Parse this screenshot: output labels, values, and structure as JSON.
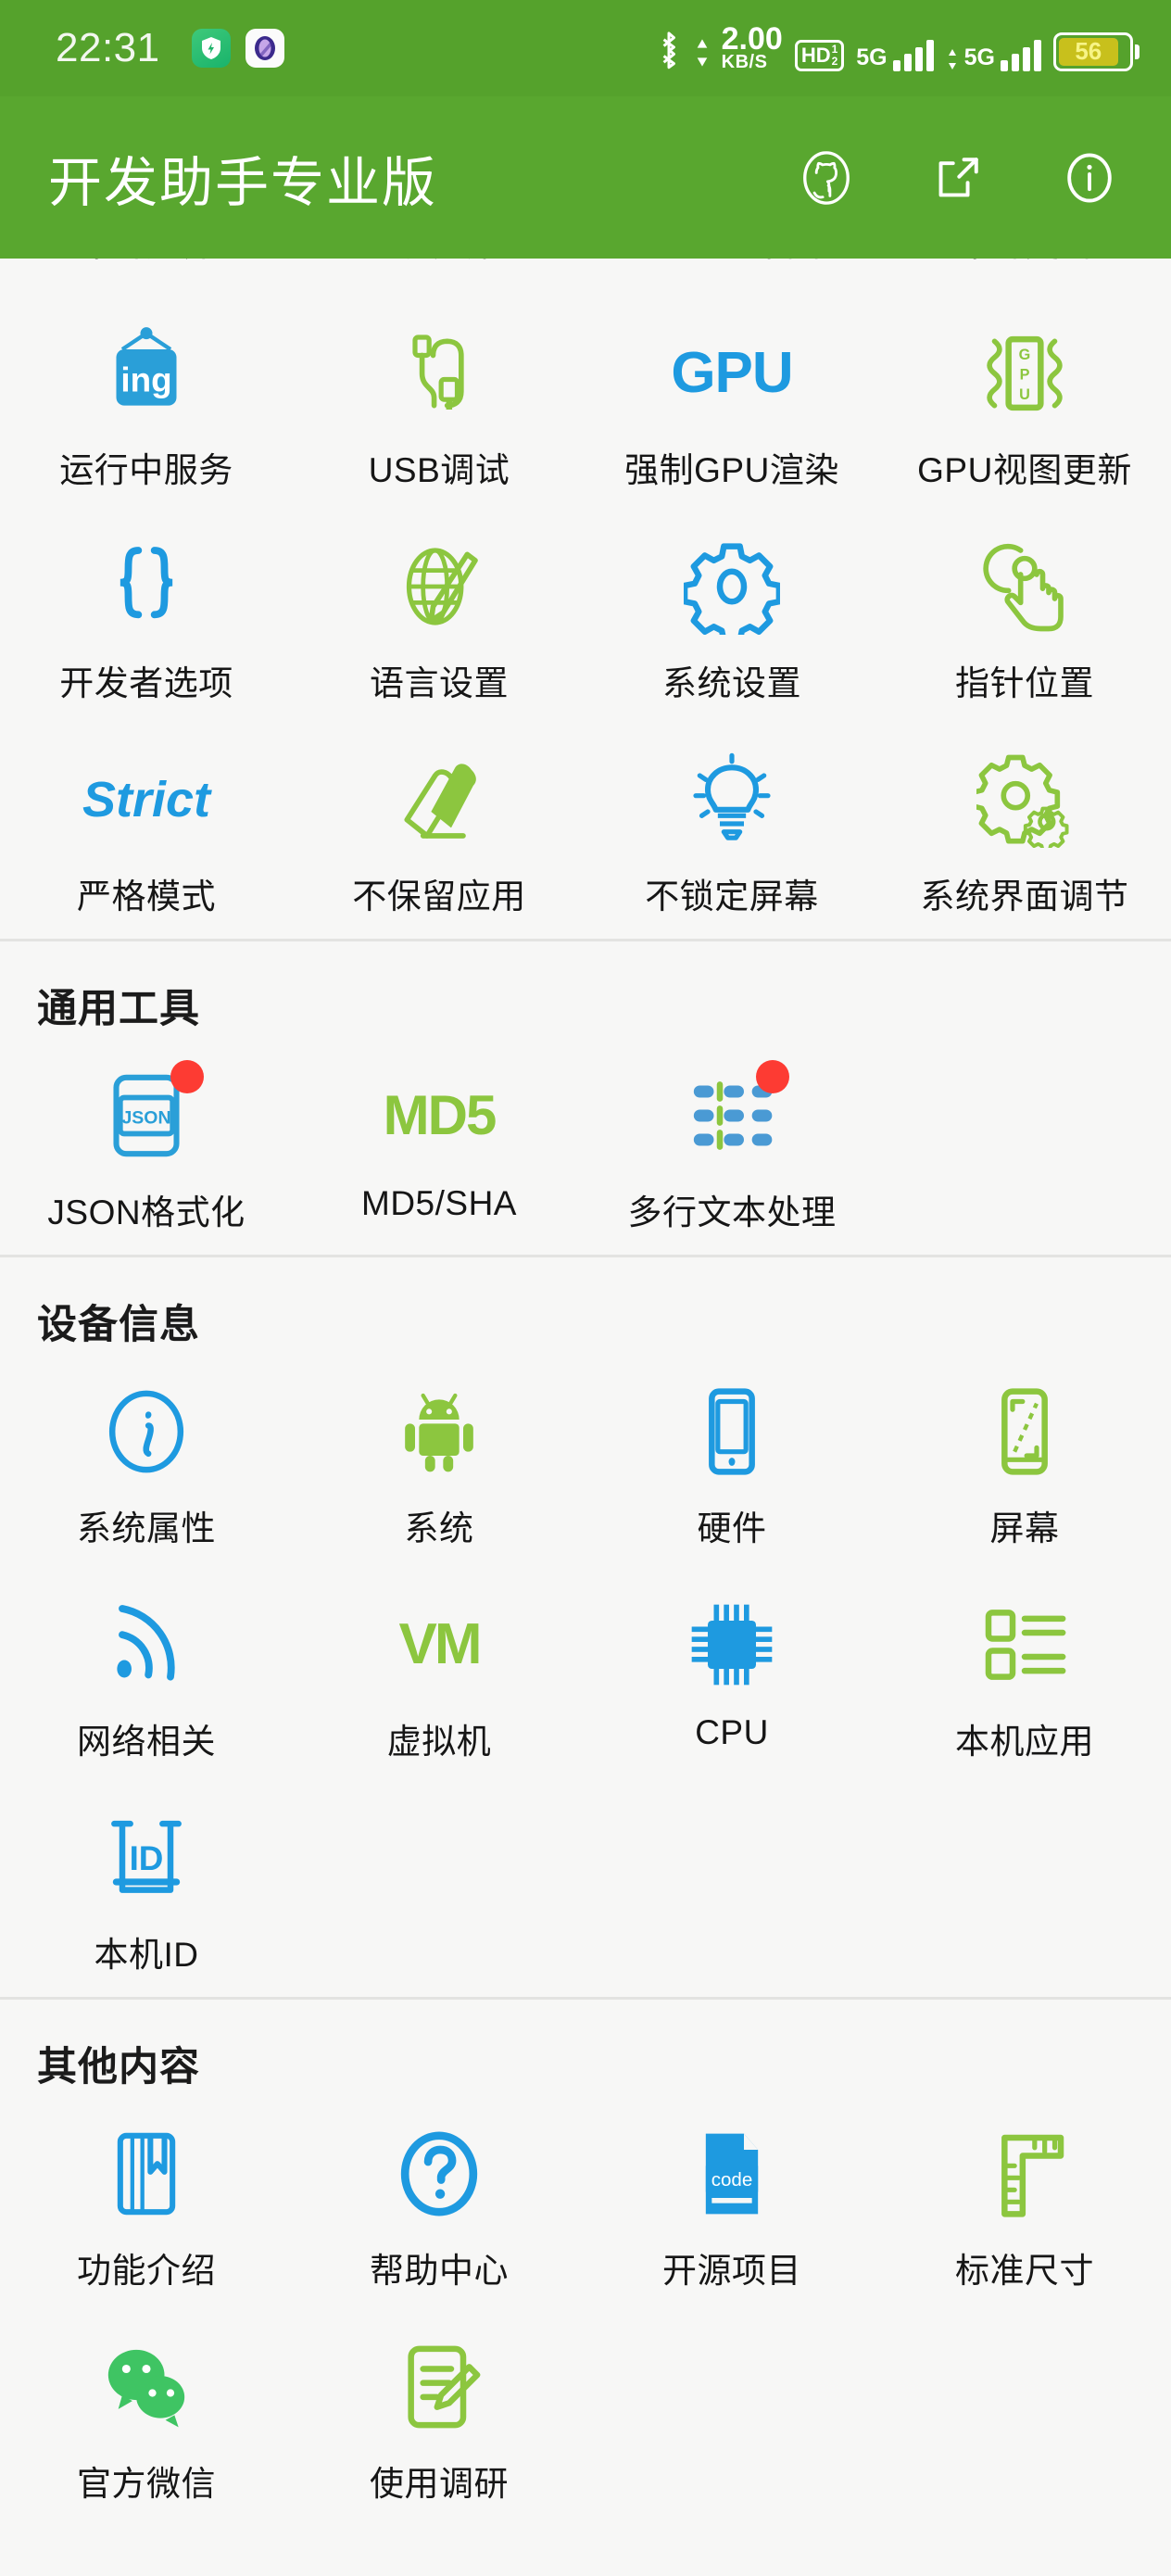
{
  "statusbar": {
    "clock": "22:31",
    "icons": [
      "shield-app-icon",
      "purple-app-icon",
      "bluetooth-icon"
    ],
    "net_speed_value": "2.00",
    "net_speed_unit": "KB/S",
    "hd_label": "HD",
    "hd_sup": "1",
    "hd_sub": "2",
    "sim1_label": "5G",
    "sim2_label": "5G",
    "battery_percent": "56"
  },
  "appbar": {
    "title": "开发助手专业版",
    "actions": [
      {
        "name": "github-icon",
        "label": "GitHub"
      },
      {
        "name": "share-icon",
        "label": "分享"
      },
      {
        "name": "info-icon",
        "label": "关于"
      }
    ]
  },
  "clipped_row": {
    "labels": [
      "布局边界",
      "过度绘制",
      "GPU渲染图",
      "布局更新"
    ]
  },
  "sections": [
    {
      "title": null,
      "items": [
        {
          "label": "运行中服务",
          "icon": "ing-sign-icon",
          "color": "#2a9fd8",
          "badge": false
        },
        {
          "label": "USB调试",
          "icon": "usb-cable-icon",
          "color": "#8cc63f",
          "badge": false
        },
        {
          "label": "强制GPU渲染",
          "icon": "gpu-text-icon",
          "color": "#1e9ae0",
          "badge": false
        },
        {
          "label": "GPU视图更新",
          "icon": "gpu-chip-icon",
          "color": "#8cc63f",
          "badge": false
        },
        {
          "label": "开发者选项",
          "icon": "braces-icon",
          "color": "#1e9ae0",
          "badge": false
        },
        {
          "label": "语言设置",
          "icon": "globe-pencil-icon",
          "color": "#8cc63f",
          "badge": false
        },
        {
          "label": "系统设置",
          "icon": "gear-icon",
          "color": "#1e9ae0",
          "badge": false
        },
        {
          "label": "指针位置",
          "icon": "tap-hand-icon",
          "color": "#8cc63f",
          "badge": false
        },
        {
          "label": "严格模式",
          "icon": "strict-text-icon",
          "color": "#1e9ae0",
          "badge": false
        },
        {
          "label": "不保留应用",
          "icon": "eraser-icon",
          "color": "#8cc63f",
          "badge": false
        },
        {
          "label": "不锁定屏幕",
          "icon": "lightbulb-icon",
          "color": "#1e9ae0",
          "badge": false
        },
        {
          "label": "系统界面调节",
          "icon": "dual-gears-icon",
          "color": "#8cc63f",
          "badge": false
        }
      ]
    },
    {
      "title": "通用工具",
      "items": [
        {
          "label": "JSON格式化",
          "icon": "json-file-icon",
          "color": "#2a9fd8",
          "badge": true
        },
        {
          "label": "MD5/SHA",
          "icon": "md5-text-icon",
          "color": "#8cc63f",
          "badge": false
        },
        {
          "label": "多行文本处理",
          "icon": "multiline-text-icon",
          "color": "#4a9ad4",
          "badge": true
        }
      ]
    },
    {
      "title": "设备信息",
      "items": [
        {
          "label": "系统属性",
          "icon": "info-circle-icon",
          "color": "#1e9ae0",
          "badge": false
        },
        {
          "label": "系统",
          "icon": "android-robot-icon",
          "color": "#8cc63f",
          "badge": false
        },
        {
          "label": "硬件",
          "icon": "phone-icon",
          "color": "#1e9ae0",
          "badge": false
        },
        {
          "label": "屏幕",
          "icon": "screen-size-icon",
          "color": "#8cc63f",
          "badge": false
        },
        {
          "label": "网络相关",
          "icon": "wifi-signal-icon",
          "color": "#1e9ae0",
          "badge": false
        },
        {
          "label": "虚拟机",
          "icon": "vm-text-icon",
          "color": "#8cc63f",
          "badge": false
        },
        {
          "label": "CPU",
          "icon": "cpu-chip-icon",
          "color": "#1e9ae0",
          "badge": false
        },
        {
          "label": "本机应用",
          "icon": "app-list-icon",
          "color": "#8cc63f",
          "badge": false
        },
        {
          "label": "本机ID",
          "icon": "id-card-icon",
          "color": "#1e9ae0",
          "badge": false
        }
      ]
    },
    {
      "title": "其他内容",
      "items": [
        {
          "label": "功能介绍",
          "icon": "book-bookmark-icon",
          "color": "#1e9ae0",
          "badge": false
        },
        {
          "label": "帮助中心",
          "icon": "question-circle-icon",
          "color": "#1e9ae0",
          "badge": false
        },
        {
          "label": "开源项目",
          "icon": "code-file-icon",
          "color": "#1e9ae0",
          "badge": false
        },
        {
          "label": "标准尺寸",
          "icon": "ruler-icon",
          "color": "#8cc63f",
          "badge": false
        },
        {
          "label": "官方微信",
          "icon": "wechat-icon",
          "color": "#3fc463",
          "badge": false
        },
        {
          "label": "使用调研",
          "icon": "survey-edit-icon",
          "color": "#8cc63f",
          "badge": false
        }
      ]
    }
  ],
  "colors": {
    "header_green": "#59a72f",
    "status_green": "#55a22c",
    "background": "#f7f7f6",
    "blue": "#1e9ae0",
    "green": "#8cc63f",
    "badge_red": "#fd3b33"
  }
}
